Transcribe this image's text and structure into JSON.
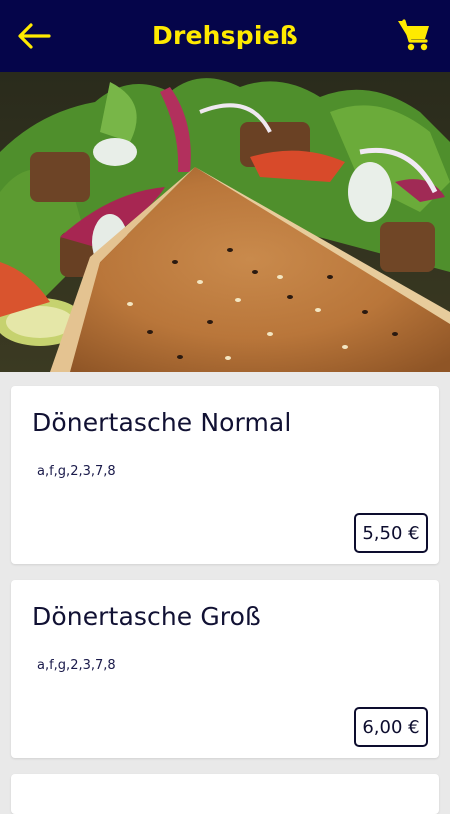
{
  "header": {
    "title": "Drehspieß",
    "back_icon": "arrow-left-icon",
    "cart_icon": "shopping-cart-icon",
    "colors": {
      "background": "#05054a",
      "accent": "#ffea00"
    }
  },
  "hero": {
    "image": "döner-bread-salad-photo"
  },
  "items": [
    {
      "name": "Dönertasche Normal",
      "allergens": "a,f,g,2,3,7,8",
      "price": "5,50 €"
    },
    {
      "name": "Dönertasche Groß",
      "allergens": "a,f,g,2,3,7,8",
      "price": "6,00 €"
    }
  ]
}
